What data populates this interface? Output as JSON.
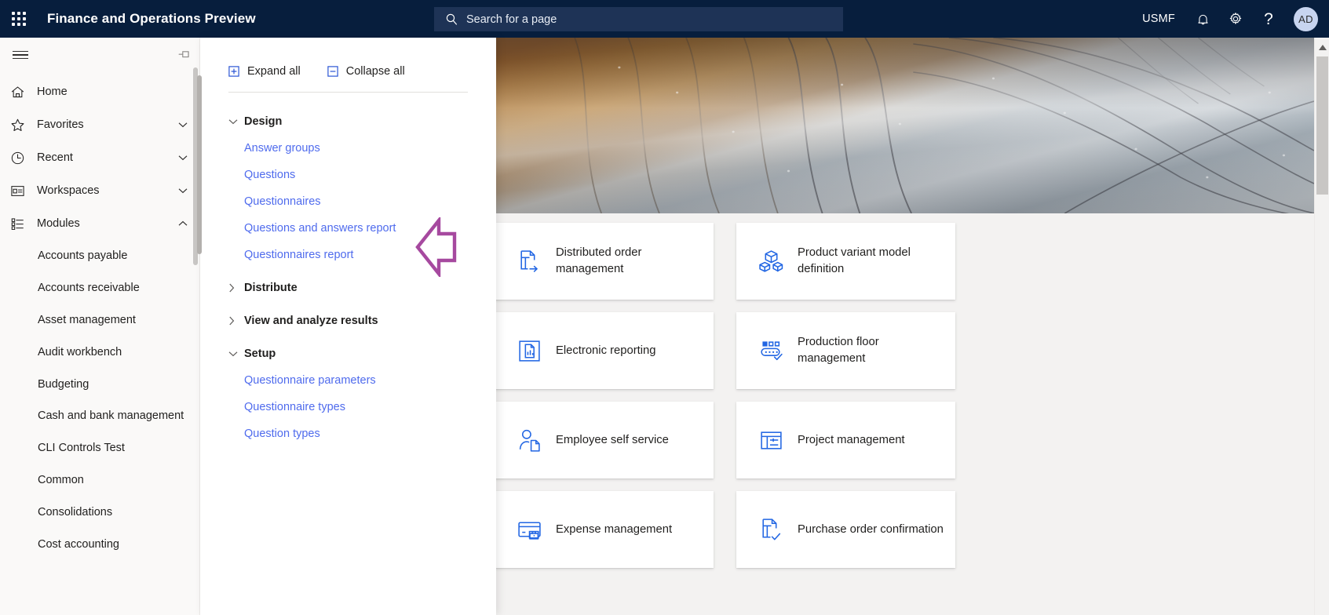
{
  "topbar": {
    "waffle_icon": "app-launcher-icon",
    "title": "Finance and Operations Preview",
    "search": {
      "placeholder": "Search for a page",
      "icon": "search-icon"
    },
    "company": "USMF",
    "notifications_icon": "bell-icon",
    "settings_icon": "gear-icon",
    "help_icon": "question-mark-icon",
    "help_label": "?",
    "avatar_initials": "AD",
    "brand_color": "#071E3D",
    "search_bg": "#1E3356",
    "avatar_bg": "#C7D4EF"
  },
  "sidebar": {
    "menu_icon": "hamburger-icon",
    "pin_icon": "pin-icon",
    "items": [
      {
        "label": "Home",
        "icon": "home-icon",
        "expandable": false
      },
      {
        "label": "Favorites",
        "icon": "star-icon",
        "expandable": true,
        "expanded": false
      },
      {
        "label": "Recent",
        "icon": "clock-icon",
        "expandable": true,
        "expanded": false
      },
      {
        "label": "Workspaces",
        "icon": "workspace-icon",
        "expandable": true,
        "expanded": false
      },
      {
        "label": "Modules",
        "icon": "modules-icon",
        "expandable": true,
        "expanded": true
      }
    ],
    "modules": [
      {
        "label": "Accounts payable"
      },
      {
        "label": "Accounts receivable"
      },
      {
        "label": "Asset management"
      },
      {
        "label": "Audit workbench"
      },
      {
        "label": "Budgeting"
      },
      {
        "label": "Cash and bank management"
      },
      {
        "label": "CLI Controls Test"
      },
      {
        "label": "Common"
      },
      {
        "label": "Consolidations"
      },
      {
        "label": "Cost accounting"
      }
    ]
  },
  "flyout": {
    "expand_all_label": "Expand all",
    "expand_all_icon": "plus-box-icon",
    "collapse_all_label": "Collapse all",
    "collapse_all_icon": "minus-box-icon",
    "tree": [
      {
        "label": "Design",
        "expanded": true,
        "chevron_icon": "chevron-down-icon",
        "children": [
          {
            "label": "Answer groups"
          },
          {
            "label": "Questions"
          },
          {
            "label": "Questionnaires"
          },
          {
            "label": "Questions and answers report"
          },
          {
            "label": "Questionnaires report"
          }
        ]
      },
      {
        "label": "Distribute",
        "expanded": false,
        "chevron_icon": "chevron-right-icon",
        "children": []
      },
      {
        "label": "View and analyze results",
        "expanded": false,
        "chevron_icon": "chevron-right-icon",
        "children": []
      },
      {
        "label": "Setup",
        "expanded": true,
        "chevron_icon": "chevron-down-icon",
        "children": [
          {
            "label": "Questionnaire parameters"
          },
          {
            "label": "Questionnaire types"
          },
          {
            "label": "Question types"
          }
        ]
      }
    ],
    "link_color": "#4F6BED"
  },
  "main": {
    "hero_alt": "metallic-building-facade-banner",
    "tiles": [
      {
        "label": "Distributed order management",
        "icon": "distributed-order-icon"
      },
      {
        "label": "Product variant model definition",
        "icon": "product-variant-icon"
      },
      {
        "label": "Electronic reporting",
        "icon": "electronic-reporting-icon"
      },
      {
        "label": "Production floor management",
        "icon": "production-floor-icon"
      },
      {
        "label": "Employee self service",
        "icon": "employee-self-service-icon"
      },
      {
        "label": "Project management",
        "icon": "project-management-icon"
      },
      {
        "label": "Expense management",
        "icon": "expense-management-icon"
      },
      {
        "label": "Purchase order confirmation",
        "icon": "purchase-order-confirmation-icon"
      }
    ],
    "tile_icon_color": "#2266E3",
    "scroll_up_icon": "scroll-up-arrow-icon"
  },
  "annotation": {
    "arrow_icon": "left-pointing-arrow-annotation",
    "color": "#A6499F"
  }
}
